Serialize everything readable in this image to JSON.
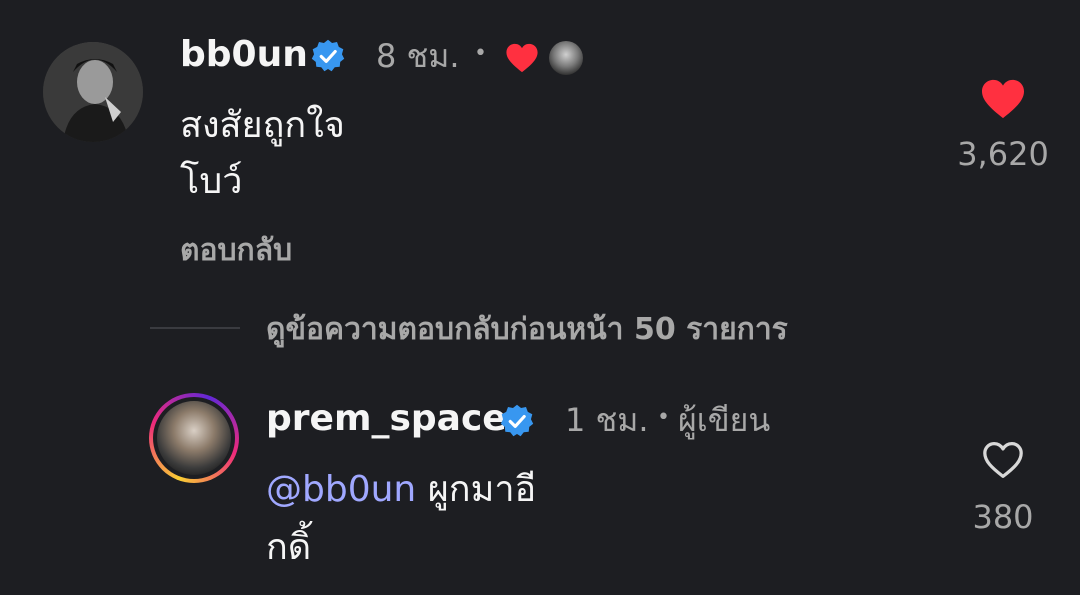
{
  "comments": [
    {
      "username": "bb0un",
      "time": "8 ชม.",
      "dot": "•",
      "text_line1": "สงสัยถูกใจ",
      "text_line2": "โบว์",
      "reply_label": "ตอบกลับ",
      "like_count": "3,620",
      "liked": true,
      "icons": [
        "verified-badge-icon",
        "heart-filled-icon",
        "author-avatar-mini"
      ]
    },
    {
      "username": "prem_space",
      "time": "1 ชม.",
      "dot": "•",
      "author_tag": "ผู้เขียน",
      "mention": "@bb0un",
      "text_after_mention": " ผูกมาอี",
      "text_line2": "กดิ้",
      "like_count": "380",
      "liked": false,
      "icons": [
        "verified-badge-icon",
        "heart-outline-icon"
      ]
    }
  ],
  "view_replies": {
    "label": "ดูข้อความตอบกลับก่อนหน้า 50 รายการ"
  },
  "colors": {
    "background": "#1d1e22",
    "text": "#f5f5f5",
    "muted": "#a8a8a8",
    "verified": "#3897f0",
    "heart": "#ff3040",
    "mention": "#a0a8ff"
  }
}
